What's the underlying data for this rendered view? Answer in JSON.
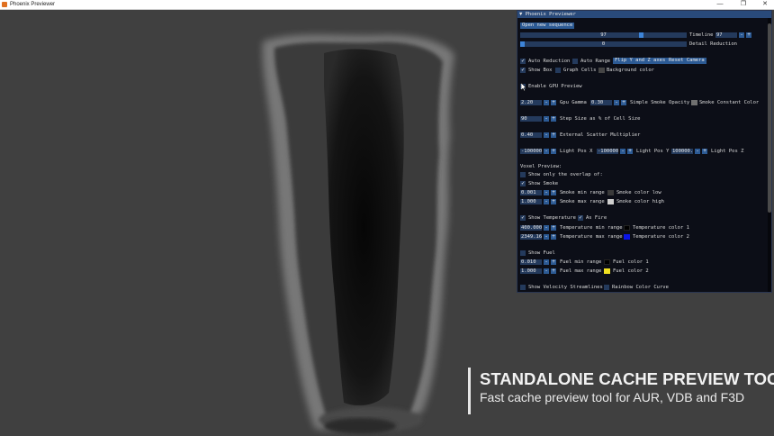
{
  "window": {
    "title": "Phoenix Previewer",
    "buttons": [
      "—",
      "❐",
      "✕"
    ]
  },
  "caption": {
    "title": "STANDALONE CACHE PREVIEW TOOL",
    "subtitle": "Fast cache preview tool for AUR, VDB and F3D"
  },
  "panel": {
    "title": "▼ Phoenix Previewer",
    "open_button": "Open new sequence",
    "timeline_slider_value": "97",
    "timeline_label": "Timeline",
    "timeline_field": "97",
    "detail_slider_value": "0",
    "detail_label": "Detail Reduction",
    "auto_reduction": "Auto Reduction",
    "auto_range": "Auto Range",
    "flip_button": "Flip Y and Z axes",
    "reset_camera": "Reset Camera",
    "show_box": "Show Box",
    "graph_cells": "Graph Cells",
    "background_color": "Background color",
    "enable_gpu": "Enable GPU Preview",
    "gpu_gamma_value": "2.20",
    "gpu_gamma_label": "Gpu Gamma",
    "smoke_opacity_value": "0.30",
    "smoke_opacity_label": "Simple Smoke Opacity",
    "smoke_constant_color": "Smoke Constant Color",
    "step_size_value": "90",
    "step_size_label": "Step Size as % of Cell Size",
    "scatter_value": "0.40",
    "scatter_label": "External Scatter Multiplier",
    "light_x_value": "-100000",
    "light_x_label": "Light Pos X",
    "light_y_value": "-100000",
    "light_y_label": "Light Pos Y",
    "light_z_value": "100000.",
    "light_z_label": "Light Pos Z",
    "voxel_preview": "Voxel Preview:",
    "show_overlap": "Show only the overlap of:",
    "show_smoke": "Show Smoke",
    "smoke_min_value": "0.001",
    "smoke_min_label": "Smoke min range",
    "smoke_color_low": "Smoke color low",
    "smoke_max_value": "1.000",
    "smoke_max_label": "Smoke max range",
    "smoke_color_high": "Smoke color high",
    "show_temperature": "Show Temperature",
    "as_fire": "As Fire",
    "temp_min_value": "400.000",
    "temp_min_label": "Temperature min range",
    "temp_color_1": "Temperature color 1",
    "temp_max_value": "2349.16",
    "temp_max_label": "Temperature max range",
    "temp_color_2": "Temperature color 2",
    "show_fuel": "Show Fuel",
    "fuel_min_value": "0.010",
    "fuel_min_label": "Fuel min range",
    "fuel_color_1": "Fuel color 1",
    "fuel_max_value": "1.000",
    "fuel_max_label": "Fuel max range",
    "fuel_color_2": "Fuel color 2",
    "show_velocity": "Show Velocity Streamlines",
    "rainbow_curve": "Rainbow Color Curve",
    "minus": "-",
    "plus": "+",
    "check": "✓"
  },
  "colors": {
    "accent": "#2c5a94",
    "frame": "#243a5c",
    "panel_bg": "#090b14",
    "viewport_bg": "#404040",
    "smoke_color_low": "#3a3a3a",
    "smoke_color_high": "#cfcfcf",
    "temperature_color_1": "#000000",
    "temperature_color_2": "#0a14e6",
    "fuel_color_1": "#000000",
    "fuel_color_2": "#f0e020",
    "smoke_constant": "#707070",
    "background": "#454545"
  }
}
